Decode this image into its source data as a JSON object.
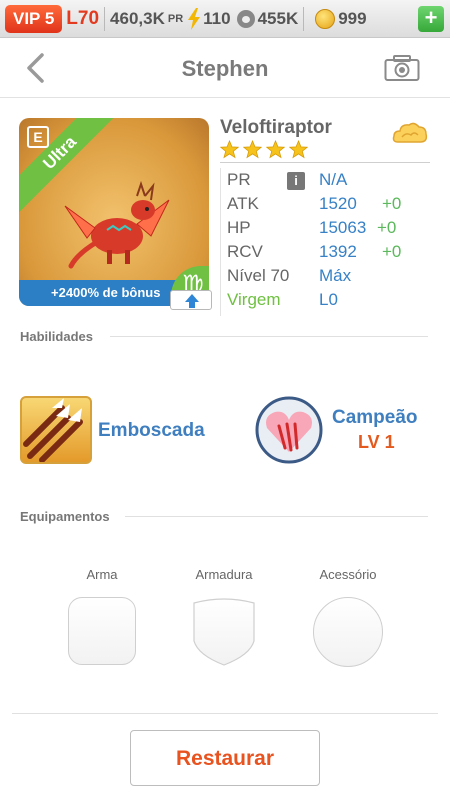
{
  "status_bar": {
    "vip": "VIP 5",
    "level": "L70",
    "pr_value": "460,3K",
    "pr_label": "PR",
    "energy": "110",
    "food": "455K",
    "gems": "999",
    "add_label": "+",
    "icons": [
      "bolt-icon",
      "paw-icon",
      "coin-icon"
    ]
  },
  "header": {
    "title": "Stephen",
    "back_icon": "chevron-left-icon",
    "camera_icon": "camera-icon"
  },
  "card": {
    "rarity": "Ultra",
    "badge": "E",
    "bonus": "+2400% de bônus",
    "zodiac_symbol": "♍"
  },
  "dragon": {
    "name": "Veloftiraptor",
    "stars": 4,
    "element_icon": "cloud-icon"
  },
  "stats": [
    {
      "label": "PR",
      "value": "N/A",
      "bonus": ""
    },
    {
      "label": "ATK",
      "value": "1520",
      "bonus": "+0"
    },
    {
      "label": "HP",
      "value": "15063",
      "bonus": "+0"
    },
    {
      "label": "RCV",
      "value": "1392",
      "bonus": "+0"
    },
    {
      "label": "Nível 70",
      "value": "Máx",
      "bonus": ""
    },
    {
      "label": "Virgem",
      "value": "L0",
      "bonus": ""
    }
  ],
  "sections": {
    "abilities": "Habilidades",
    "equipment": "Equipamentos"
  },
  "skills": [
    {
      "name": "Emboscada",
      "level": ""
    },
    {
      "name": "Campeão",
      "level": "LV 1"
    }
  ],
  "equipment": {
    "weapon": "Arma",
    "armor": "Armadura",
    "accessory": "Acessório"
  },
  "actions": {
    "restore": "Restaurar"
  },
  "colors": {
    "accent_blue": "#3781c6",
    "accent_orange": "#e8531f",
    "green": "#6fc043"
  }
}
